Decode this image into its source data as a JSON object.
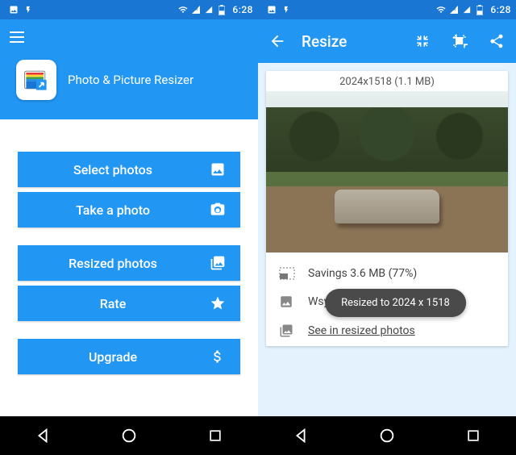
{
  "status": {
    "time": "6:28"
  },
  "left": {
    "appTitle": "Photo & Picture Resizer",
    "actions": {
      "select": "Select photos",
      "take": "Take a photo",
      "resized": "Resized photos",
      "rate": "Rate",
      "upgrade": "Upgrade"
    }
  },
  "right": {
    "title": "Resize",
    "dimensions": "2024x1518 (1.1 MB)",
    "savings": "Savings 3.6 MB (77%)",
    "wsy": "Wsy",
    "seeLink": "See in resized photos",
    "toast": "Resized to 2024 x 1518"
  }
}
